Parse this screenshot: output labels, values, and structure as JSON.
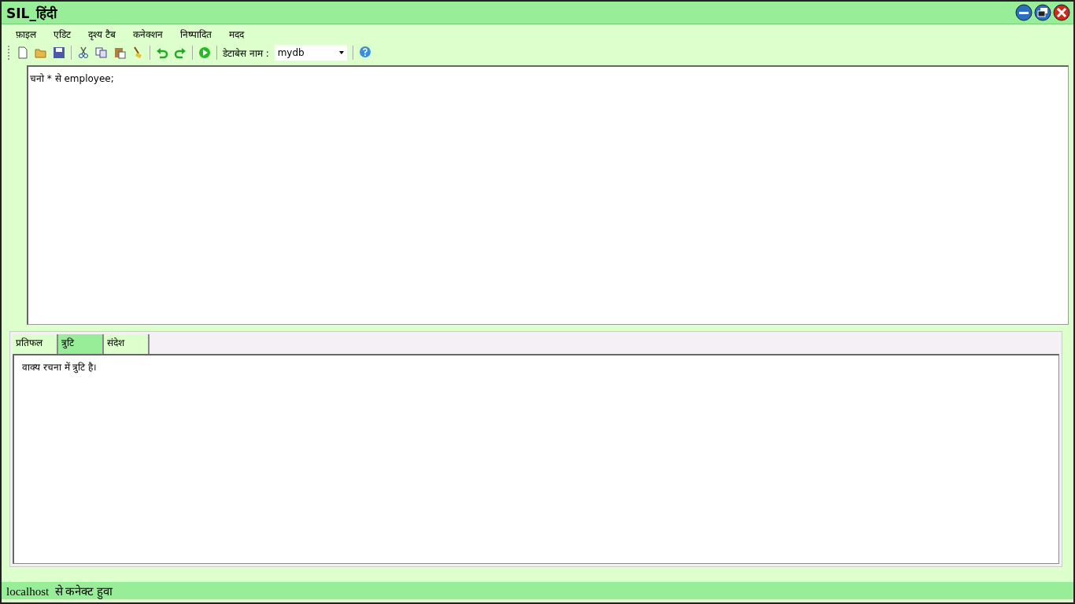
{
  "window": {
    "title": "SIL_हिंदी"
  },
  "menu": [
    "फ़ाइल",
    "एडिट",
    "दृश्य टैब",
    "कनेक्शन",
    "निष्पादित",
    "मदद"
  ],
  "toolbar": {
    "database_label": "डेटाबेस नाम :",
    "database": "mydb"
  },
  "editor": {
    "value": "चनो * से employee;"
  },
  "tabs": [
    {
      "label": "प्रतिफल",
      "selected": false
    },
    {
      "label": "त्रुटि",
      "selected": true
    },
    {
      "label": "संदेश",
      "selected": false
    }
  ],
  "output": "वाक्य रचना में त्रुटि है।",
  "status_bar": "localhost  से कनेक्ट हुवा"
}
